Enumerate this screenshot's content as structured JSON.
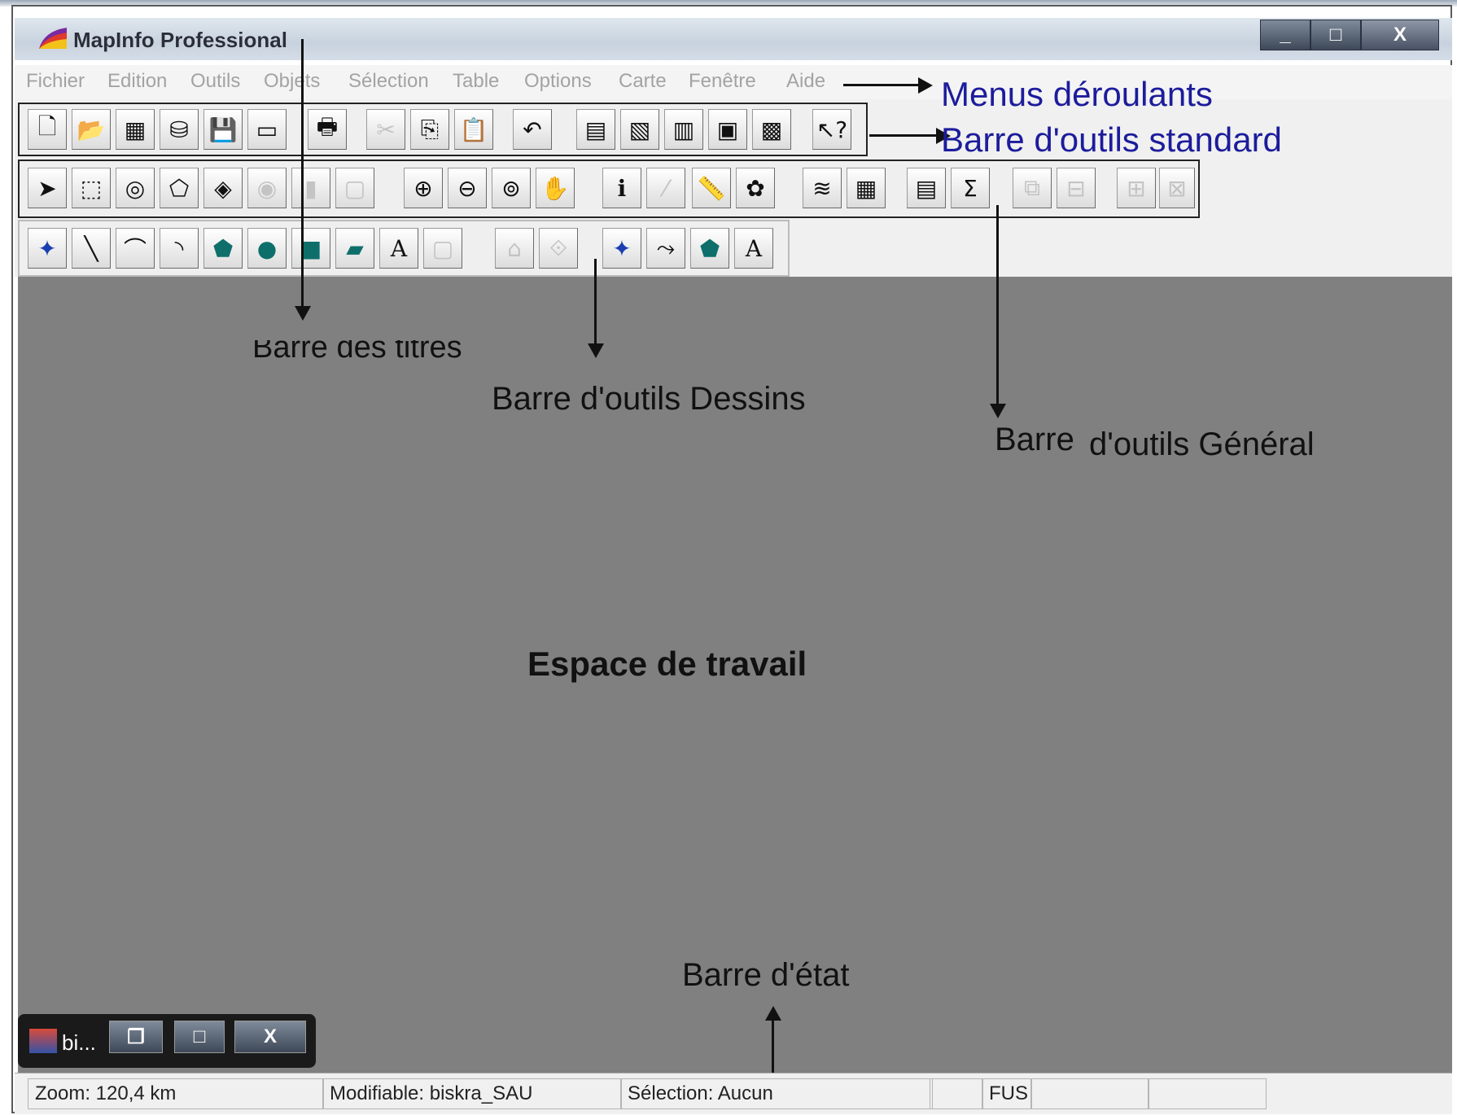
{
  "window": {
    "title": "MapInfo Professional",
    "buttons": [
      "_",
      "□",
      "X"
    ]
  },
  "menu": [
    "Fichier",
    "Edition",
    "Outils",
    "Objets",
    "Sélection",
    "Table",
    "Options",
    "Carte",
    "Fenêtre",
    "Aide"
  ],
  "toolbars": {
    "standard_icons": [
      "new-icon",
      "open-icon",
      "open-workspace-icon",
      "open-dbms-icon",
      "save-icon",
      "new-window-icon",
      "print-icon",
      "cut-icon",
      "copy-icon",
      "paste-icon",
      "undo-icon",
      "browser-icon",
      "map-icon",
      "graph-icon",
      "layout-icon",
      "redistrict-icon",
      "help-icon"
    ],
    "general_icons": [
      "select-icon",
      "marquee-select-icon",
      "radius-select-icon",
      "polygon-select-icon",
      "boundary-select-icon",
      "invert-select-icon",
      "label-select-icon",
      "graph-select-icon",
      "zoom-in-icon",
      "zoom-out-icon",
      "change-view-icon",
      "grabber-icon",
      "info-icon",
      "hotlink-icon",
      "ruler-icon",
      "label-icon",
      "layer-control-icon",
      "legend-icon",
      "statistics-icon",
      "sum-icon",
      "drag-window-icon",
      "clip-region-icon",
      "redistrict-add-icon",
      "redistrict-remove-icon"
    ],
    "drawing_icons": [
      "symbol-icon",
      "line-icon",
      "polyline-icon",
      "arc-icon",
      "polygon-icon",
      "ellipse-icon",
      "rectangle-icon",
      "rounded-rect-icon",
      "text-icon",
      "frame-icon",
      "reshape-icon",
      "add-node-icon",
      "symbol-style-icon",
      "line-style-icon",
      "region-style-icon",
      "text-style-icon"
    ]
  },
  "annotations": {
    "menus": "Menus déroulants",
    "standard": "Barre d'outils standard",
    "titles": "Barre des titres",
    "drawing": "Barre d'outils Dessins",
    "general_left": "Barre",
    "general_right": "d'outils Général",
    "workspace": "Espace de  travail",
    "status": "Barre d'état"
  },
  "minimized": {
    "label": "bi..."
  },
  "statusbar": {
    "zoom": "Zoom: 120,4 km",
    "editable": "Modifiable: biskra_SAU",
    "selection": "Sélection: Aucun",
    "mode": "FUS"
  },
  "colors": {
    "annotation_blue": "#1c1c9c",
    "workspace_gray": "#808080"
  }
}
